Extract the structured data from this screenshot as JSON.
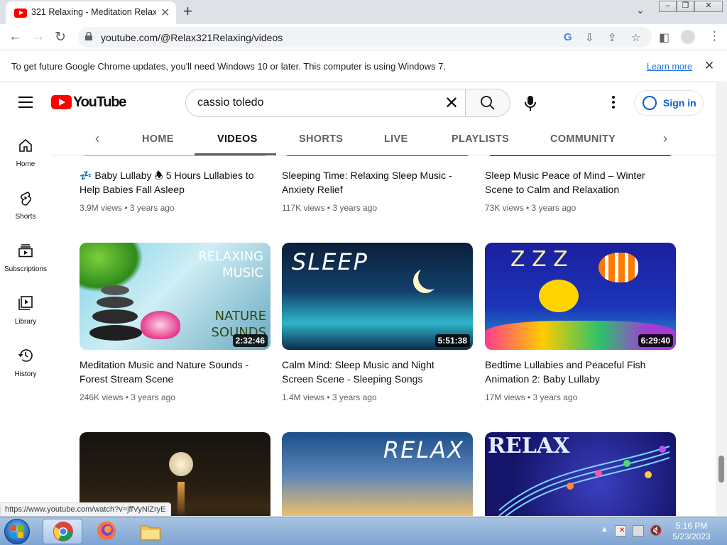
{
  "browser": {
    "tab_title": "321 Relaxing - Meditation Relax",
    "url": "youtube.com/@Relax321Relaxing/videos",
    "infobar_message": "To get future Google Chrome updates, you'll need Windows 10 or later. This computer is using Windows 7.",
    "infobar_link": "Learn more",
    "status_url": "https://www.youtube.com/watch?v=jffVyNlZryE"
  },
  "youtube": {
    "logo_text": "YouTube",
    "search_value": "cassio toledo",
    "sign_in": "Sign in",
    "nav": [
      {
        "label": "Home",
        "icon": "home-icon"
      },
      {
        "label": "Shorts",
        "icon": "shorts-icon"
      },
      {
        "label": "Subscriptions",
        "icon": "subscriptions-icon"
      },
      {
        "label": "Library",
        "icon": "library-icon"
      },
      {
        "label": "History",
        "icon": "history-icon"
      }
    ],
    "tabs": [
      "HOME",
      "VIDEOS",
      "SHORTS",
      "LIVE",
      "PLAYLISTS",
      "COMMUNITY"
    ],
    "active_tab": "VIDEOS",
    "videos": [
      {
        "title": "💤 Baby Lullaby 🕭 5 Hours Lullabies to Help Babies Fall Asleep",
        "meta": "3.9M views • 3 years ago",
        "duration": ""
      },
      {
        "title": "Sleeping Time: Relaxing Sleep Music - Anxiety Relief",
        "meta": "117K views • 3 years ago",
        "duration": ""
      },
      {
        "title": "Sleep Music Peace of Mind – Winter Scene to Calm and Relaxation",
        "meta": "73K views • 3 years ago",
        "duration": ""
      },
      {
        "title": "Meditation Music and Nature Sounds - Forest Stream Scene",
        "meta": "246K views • 3 years ago",
        "duration": "2:32:46",
        "thumb_text": [
          "RELAXING",
          "MUSIC",
          "NATURE",
          "SOUNDS"
        ]
      },
      {
        "title": "Calm Mind: Sleep Music and Night Screen Scene - Sleeping Songs",
        "meta": "1.4M views • 3 years ago",
        "duration": "5:51:38",
        "thumb_text": [
          "SLEEP"
        ]
      },
      {
        "title": "Bedtime Lullabies and Peaceful Fish Animation 2: Baby Lullaby",
        "meta": "17M views • 3 years ago",
        "duration": "6:29:40",
        "thumb_text": [
          "Z Z Z"
        ]
      },
      {
        "title": "",
        "meta": "",
        "duration": ""
      },
      {
        "title": "",
        "meta": "",
        "duration": "",
        "thumb_text": [
          "RELAX"
        ]
      },
      {
        "title": "",
        "meta": "",
        "duration": "",
        "thumb_text": [
          "RELAX"
        ]
      }
    ]
  },
  "taskbar": {
    "time": "5:16 PM",
    "date": "5/23/2023"
  },
  "colors": {
    "youtube_red": "#ff0000",
    "link_blue": "#065fd4",
    "chrome_blue": "#1a73e8"
  }
}
